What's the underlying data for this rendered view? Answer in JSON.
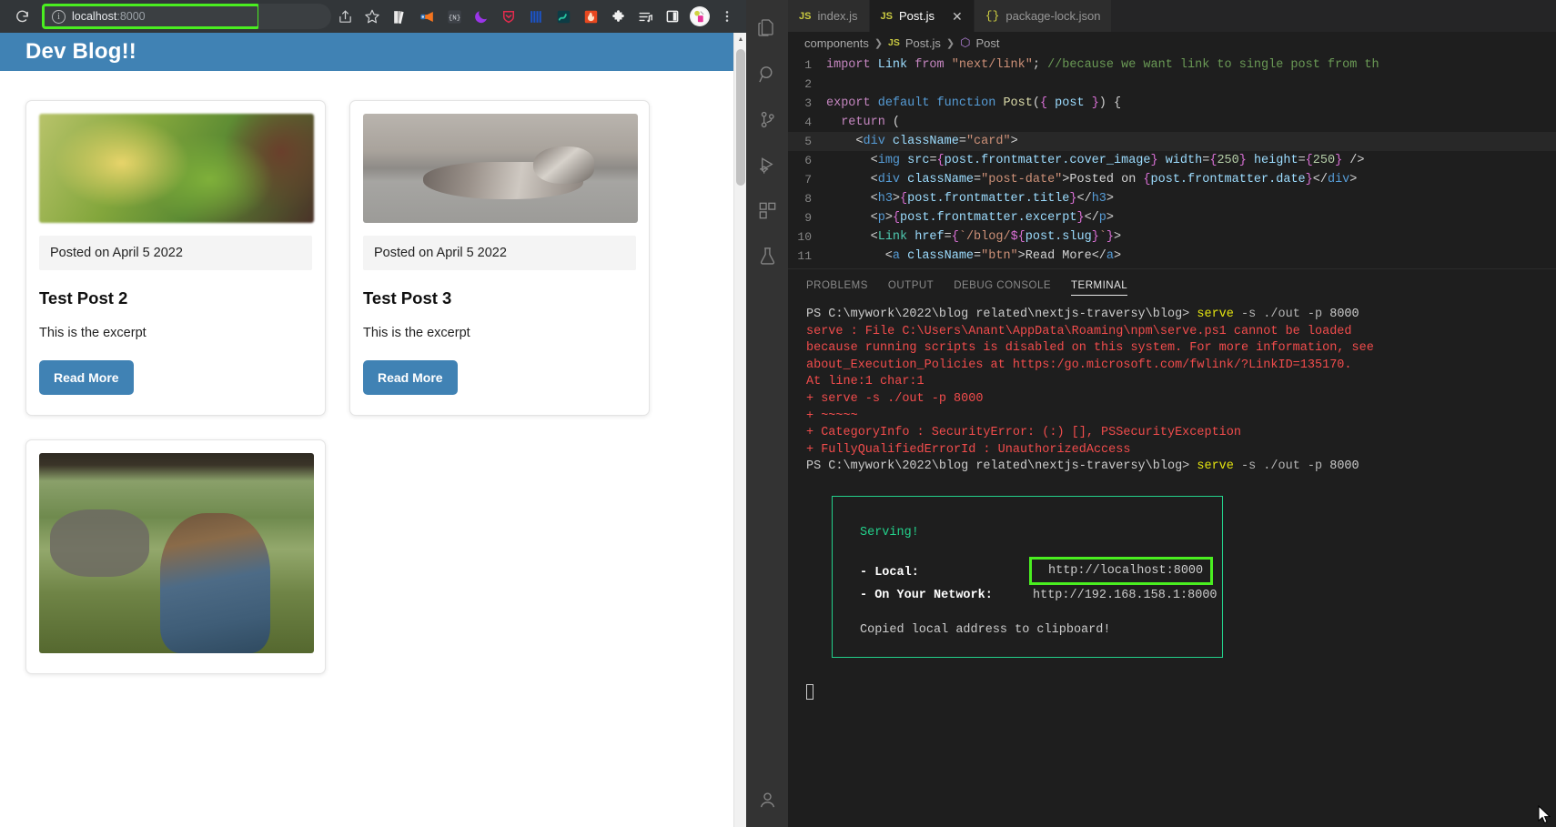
{
  "browser": {
    "reload_icon": "reload-icon",
    "url_prefix": "localhost",
    "url_suffix": ":8000",
    "info_icon": "info-icon",
    "toolbar_icons": [
      {
        "name": "share-icon"
      },
      {
        "name": "bookmark-star-icon"
      },
      {
        "name": "book-extension-icon"
      },
      {
        "name": "megaphone-extension-icon"
      },
      {
        "name": "nativescript-extension-icon"
      },
      {
        "name": "dark-reader-moon-icon"
      },
      {
        "name": "shield-privacy-icon"
      },
      {
        "name": "notion-extension-icon"
      },
      {
        "name": "teal-extension-icon"
      },
      {
        "name": "fire-extension-icon"
      },
      {
        "name": "puzzle-extensions-icon"
      },
      {
        "name": "playlist-extension-icon"
      },
      {
        "name": "sidebar-toggle-icon"
      }
    ],
    "avatar_label": "profile-avatar",
    "menu_label": "browser-menu-icon"
  },
  "page": {
    "site_title": "Dev Blog!!",
    "cards": [
      {
        "image": "blurred-green-leaves",
        "date": "Posted on April 5 2022",
        "title": "Test Post 2",
        "excerpt": "This is the excerpt",
        "button": "Read More"
      },
      {
        "image": "husky-dog-lying-on-floor",
        "date": "Posted on April 5 2022",
        "title": "Test Post 3",
        "excerpt": "This is the excerpt",
        "button": "Read More"
      },
      {
        "image": "woman-watching-elephants-on-safari",
        "date": "",
        "title": "",
        "excerpt": "",
        "button": ""
      }
    ]
  },
  "vscode": {
    "activity_bar": [
      {
        "name": "explorer-icon",
        "active": false
      },
      {
        "name": "search-icon",
        "active": false
      },
      {
        "name": "source-control-icon",
        "active": false
      },
      {
        "name": "run-and-debug-icon",
        "active": false
      },
      {
        "name": "extensions-icon",
        "active": false
      },
      {
        "name": "testing-icon",
        "active": false
      },
      {
        "name": "account-icon",
        "active": false
      }
    ],
    "tabs": [
      {
        "label": "index.js",
        "badge": "JS",
        "active": false,
        "closable": false
      },
      {
        "label": "Post.js",
        "badge": "JS",
        "active": true,
        "closable": true
      },
      {
        "label": "package-lock.json",
        "badge": "{}",
        "active": false,
        "closable": false
      }
    ],
    "breadcrumb": [
      "components",
      "Post.js",
      "Post"
    ],
    "code": [
      {
        "num": "1",
        "segments": [
          {
            "t": "import ",
            "c": "k-import"
          },
          {
            "t": "Link ",
            "c": "k-attr"
          },
          {
            "t": "from ",
            "c": "k-import"
          },
          {
            "t": "\"next/link\"",
            "c": "k-str"
          },
          {
            "t": "; ",
            "c": "k-plain"
          },
          {
            "t": "//because we want link to single post from th",
            "c": "k-com"
          }
        ]
      },
      {
        "num": "2",
        "segments": []
      },
      {
        "num": "3",
        "segments": [
          {
            "t": "export ",
            "c": "k-import"
          },
          {
            "t": "default ",
            "c": "k-kw"
          },
          {
            "t": "function ",
            "c": "k-kw"
          },
          {
            "t": "Post",
            "c": "k-fn"
          },
          {
            "t": "(",
            "c": "k-plain"
          },
          {
            "t": "{ ",
            "c": "k-brace"
          },
          {
            "t": "post ",
            "c": "k-attr"
          },
          {
            "t": "}",
            "c": "k-brace"
          },
          {
            "t": ") {",
            "c": "k-plain"
          }
        ]
      },
      {
        "num": "4",
        "segments": [
          {
            "t": "  ",
            "c": "k-plain"
          },
          {
            "t": "return",
            "c": "k-import"
          },
          {
            "t": " (",
            "c": "k-plain"
          }
        ]
      },
      {
        "num": "5",
        "hl": true,
        "segments": [
          {
            "t": "    <",
            "c": "k-punct"
          },
          {
            "t": "div ",
            "c": "k-tag"
          },
          {
            "t": "className",
            "c": "k-attr"
          },
          {
            "t": "=",
            "c": "k-plain"
          },
          {
            "t": "\"card\"",
            "c": "k-str"
          },
          {
            "t": ">",
            "c": "k-punct"
          }
        ]
      },
      {
        "num": "6",
        "segments": [
          {
            "t": "      <",
            "c": "k-punct"
          },
          {
            "t": "img ",
            "c": "k-tag"
          },
          {
            "t": "src",
            "c": "k-attr"
          },
          {
            "t": "=",
            "c": "k-plain"
          },
          {
            "t": "{",
            "c": "k-brace"
          },
          {
            "t": "post.frontmatter.cover_image",
            "c": "k-attr"
          },
          {
            "t": "} ",
            "c": "k-brace"
          },
          {
            "t": "width",
            "c": "k-attr"
          },
          {
            "t": "=",
            "c": "k-plain"
          },
          {
            "t": "{",
            "c": "k-brace"
          },
          {
            "t": "250",
            "c": "k-num"
          },
          {
            "t": "} ",
            "c": "k-brace"
          },
          {
            "t": "height",
            "c": "k-attr"
          },
          {
            "t": "=",
            "c": "k-plain"
          },
          {
            "t": "{",
            "c": "k-brace"
          },
          {
            "t": "250",
            "c": "k-num"
          },
          {
            "t": "} ",
            "c": "k-brace"
          },
          {
            "t": "/>",
            "c": "k-punct"
          }
        ]
      },
      {
        "num": "7",
        "segments": [
          {
            "t": "      <",
            "c": "k-punct"
          },
          {
            "t": "div ",
            "c": "k-tag"
          },
          {
            "t": "className",
            "c": "k-attr"
          },
          {
            "t": "=",
            "c": "k-plain"
          },
          {
            "t": "\"post-date\"",
            "c": "k-str"
          },
          {
            "t": ">",
            "c": "k-punct"
          },
          {
            "t": "Posted on ",
            "c": "k-plain"
          },
          {
            "t": "{",
            "c": "k-brace"
          },
          {
            "t": "post.frontmatter.date",
            "c": "k-attr"
          },
          {
            "t": "}",
            "c": "k-brace"
          },
          {
            "t": "</",
            "c": "k-punct"
          },
          {
            "t": "div",
            "c": "k-tag"
          },
          {
            "t": ">",
            "c": "k-punct"
          }
        ]
      },
      {
        "num": "8",
        "segments": [
          {
            "t": "      <",
            "c": "k-punct"
          },
          {
            "t": "h3",
            "c": "k-tag"
          },
          {
            "t": ">",
            "c": "k-punct"
          },
          {
            "t": "{",
            "c": "k-brace"
          },
          {
            "t": "post.frontmatter.title",
            "c": "k-attr"
          },
          {
            "t": "}",
            "c": "k-brace"
          },
          {
            "t": "</",
            "c": "k-punct"
          },
          {
            "t": "h3",
            "c": "k-tag"
          },
          {
            "t": ">",
            "c": "k-punct"
          }
        ]
      },
      {
        "num": "9",
        "segments": [
          {
            "t": "      <",
            "c": "k-punct"
          },
          {
            "t": "p",
            "c": "k-tag"
          },
          {
            "t": ">",
            "c": "k-punct"
          },
          {
            "t": "{",
            "c": "k-brace"
          },
          {
            "t": "post.frontmatter.excerpt",
            "c": "k-attr"
          },
          {
            "t": "}",
            "c": "k-brace"
          },
          {
            "t": "</",
            "c": "k-punct"
          },
          {
            "t": "p",
            "c": "k-tag"
          },
          {
            "t": ">",
            "c": "k-punct"
          }
        ]
      },
      {
        "num": "10",
        "segments": [
          {
            "t": "      <",
            "c": "k-punct"
          },
          {
            "t": "Link ",
            "c": "k-comp"
          },
          {
            "t": "href",
            "c": "k-attr"
          },
          {
            "t": "=",
            "c": "k-plain"
          },
          {
            "t": "{",
            "c": "k-brace"
          },
          {
            "t": "`/blog/",
            "c": "k-str"
          },
          {
            "t": "${",
            "c": "k-brace"
          },
          {
            "t": "post.slug",
            "c": "k-attr"
          },
          {
            "t": "}",
            "c": "k-brace"
          },
          {
            "t": "`",
            "c": "k-str"
          },
          {
            "t": "}",
            "c": "k-brace"
          },
          {
            "t": ">",
            "c": "k-punct"
          }
        ]
      },
      {
        "num": "11",
        "segments": [
          {
            "t": "        <",
            "c": "k-punct"
          },
          {
            "t": "a ",
            "c": "k-tag"
          },
          {
            "t": "className",
            "c": "k-attr"
          },
          {
            "t": "=",
            "c": "k-plain"
          },
          {
            "t": "\"btn\"",
            "c": "k-str"
          },
          {
            "t": ">",
            "c": "k-punct"
          },
          {
            "t": "Read More",
            "c": "k-plain"
          },
          {
            "t": "</",
            "c": "k-punct"
          },
          {
            "t": "a",
            "c": "k-tag"
          },
          {
            "t": ">",
            "c": "k-punct"
          }
        ]
      }
    ],
    "panel_tabs": [
      {
        "label": "PROBLEMS",
        "active": false
      },
      {
        "label": "OUTPUT",
        "active": false
      },
      {
        "label": "DEBUG CONSOLE",
        "active": false
      },
      {
        "label": "TERMINAL",
        "active": true
      }
    ],
    "terminal": {
      "prompt1_path": "PS C:\\mywork\\2022\\blog related\\nextjs-traversy\\blog> ",
      "prompt1_cmd": "serve",
      "prompt1_args": " -s ./out -p ",
      "prompt1_port": "8000",
      "error_lines": [
        "serve : File C:\\Users\\Anant\\AppData\\Roaming\\npm\\serve.ps1 cannot be loaded",
        "because running scripts is disabled on this system. For more information, see",
        "about_Execution_Policies at https:/go.microsoft.com/fwlink/?LinkID=135170.",
        "At line:1 char:1",
        "+ serve -s ./out -p 8000",
        "+ ~~~~~",
        "    + CategoryInfo          : SecurityError: (:) [], PSSecurityException",
        "    + FullyQualifiedErrorId : UnauthorizedAccess"
      ],
      "prompt2_path": "PS C:\\mywork\\2022\\blog related\\nextjs-traversy\\blog> ",
      "prompt2_cmd": "serve",
      "prompt2_args": " -s ./out -p ",
      "prompt2_port": "8000",
      "serving_title": "Serving!",
      "local_label": "- Local:",
      "local_url": "http://localhost:8000",
      "network_label": "- On Your Network:",
      "network_url": "http://192.168.158.1:8000",
      "copied_msg": "Copied local address to clipboard!"
    }
  },
  "colors": {
    "highlight_green": "#4aee20",
    "serving_border": "#23d18b",
    "blog_accent": "#4082b4",
    "terminal_error": "#f14c4c"
  }
}
